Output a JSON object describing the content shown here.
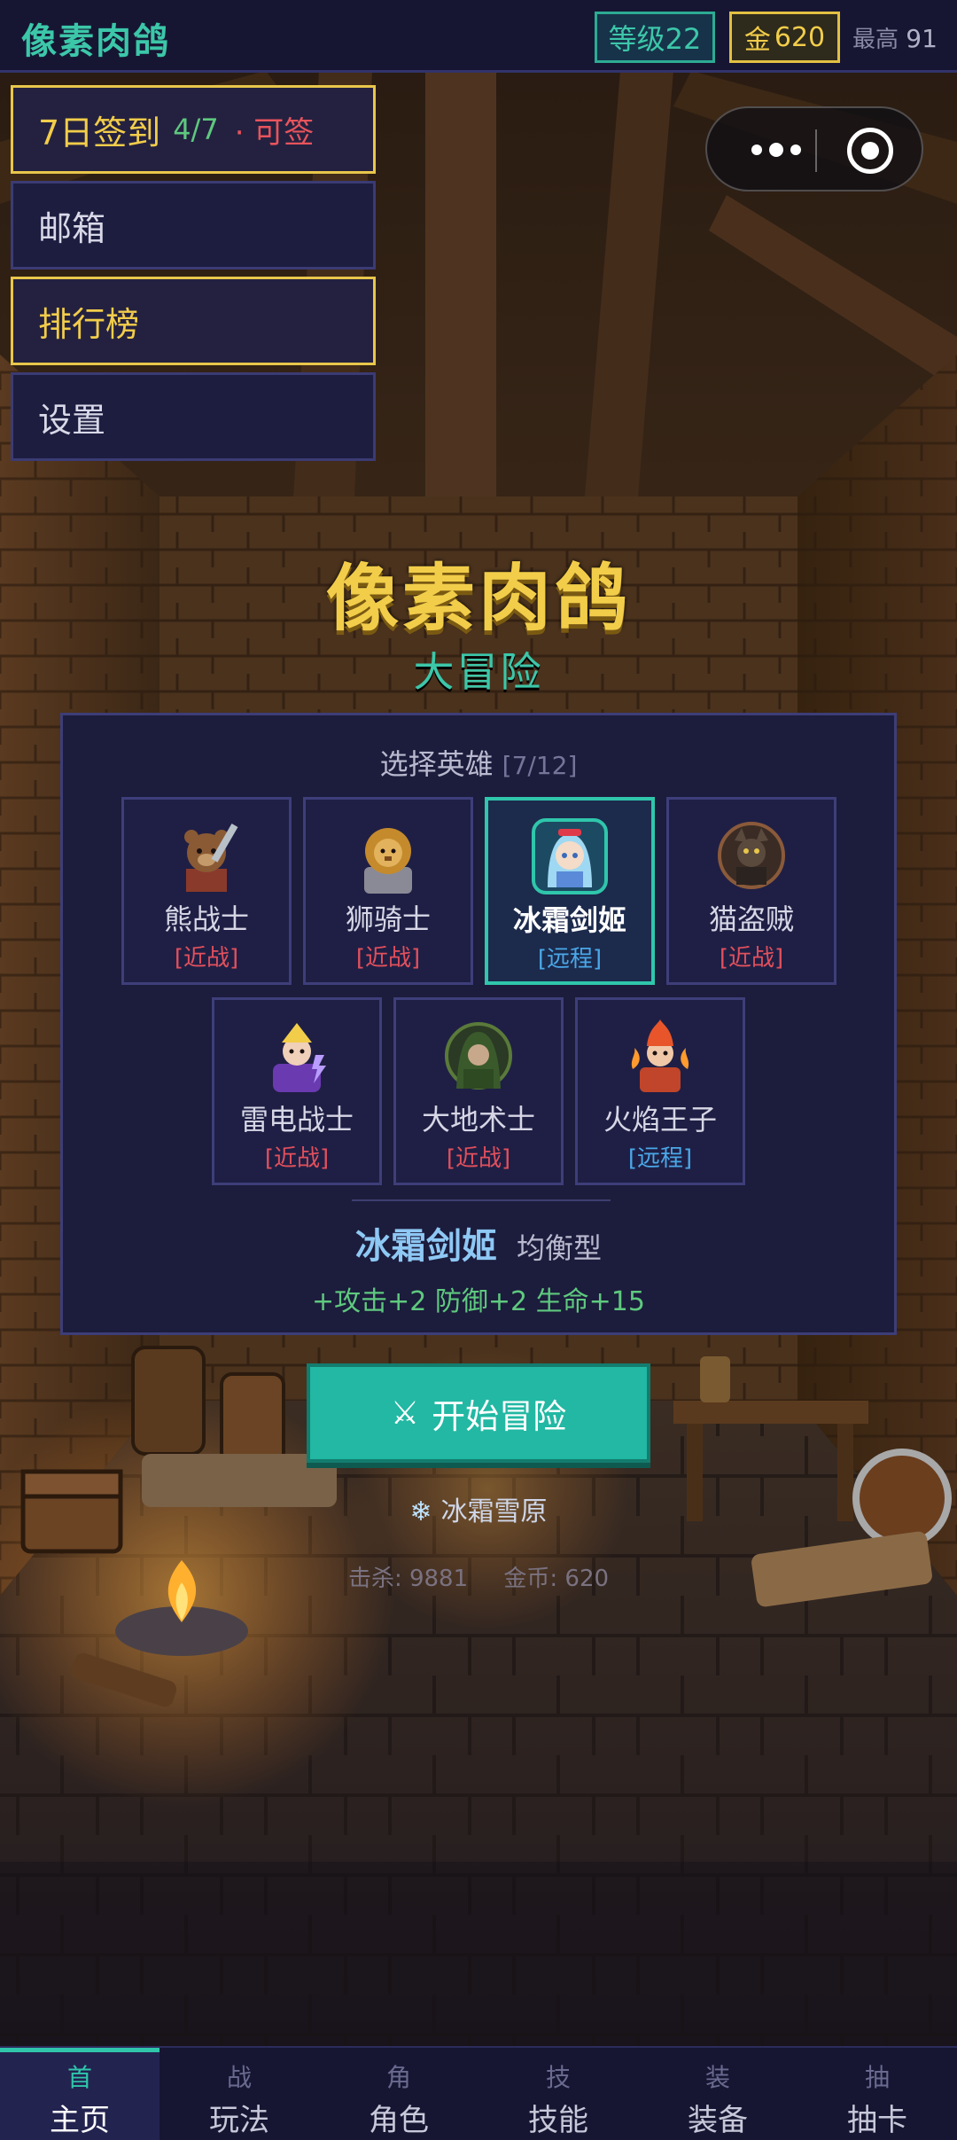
{
  "topbar": {
    "brand": "像素肉鸽",
    "level": "等级22",
    "gold_label": "金",
    "gold_value": "620",
    "best_label": "最高",
    "best_value": "91"
  },
  "side_menu": {
    "checkin_label": "7日签到",
    "checkin_progress": "4/7",
    "checkin_status": "· 可签",
    "mailbox": "邮箱",
    "leaderboard": "排行榜",
    "settings": "设置"
  },
  "game": {
    "title": "像素肉鸽",
    "subtitle": "大冒险"
  },
  "hero_select": {
    "heading": "选择英雄",
    "count": "[7/12]",
    "heroes": [
      {
        "name": "熊战士",
        "type": "[近战]",
        "kind": "melee",
        "icon": "bear-warrior-icon"
      },
      {
        "name": "狮骑士",
        "type": "[近战]",
        "kind": "melee",
        "icon": "lion-knight-icon"
      },
      {
        "name": "冰霜剑姬",
        "type": "[远程]",
        "kind": "ranged",
        "icon": "frost-swordmaiden-icon",
        "selected": true
      },
      {
        "name": "猫盗贼",
        "type": "[近战]",
        "kind": "melee",
        "icon": "cat-rogue-icon"
      },
      {
        "name": "雷电战士",
        "type": "[近战]",
        "kind": "melee",
        "icon": "thunder-warrior-icon"
      },
      {
        "name": "大地术士",
        "type": "[近战]",
        "kind": "melee",
        "icon": "earth-warlock-icon"
      },
      {
        "name": "火焰王子",
        "type": "[远程]",
        "kind": "ranged",
        "icon": "fire-prince-icon"
      }
    ],
    "selected_name": "冰霜剑姬",
    "selected_style": "均衡型",
    "selected_stats": "+攻击+2 防御+2 生命+15"
  },
  "start_button": "开始冒险",
  "region": "冰霜雪原",
  "footer_stats": {
    "kills": "击杀: 9881",
    "coins": "金币: 620"
  },
  "bottom_nav": [
    {
      "icon_char": "首",
      "label": "主页",
      "active": true
    },
    {
      "icon_char": "战",
      "label": "玩法"
    },
    {
      "icon_char": "角",
      "label": "角色"
    },
    {
      "icon_char": "技",
      "label": "技能"
    },
    {
      "icon_char": "装",
      "label": "装备"
    },
    {
      "icon_char": "抽",
      "label": "抽卡"
    }
  ],
  "colors": {
    "accent": "#2fc6ab",
    "gold": "#f2cd4a",
    "melee": "#e2505c",
    "ranged": "#4aa8e8",
    "panel": "#1c1c3c"
  }
}
